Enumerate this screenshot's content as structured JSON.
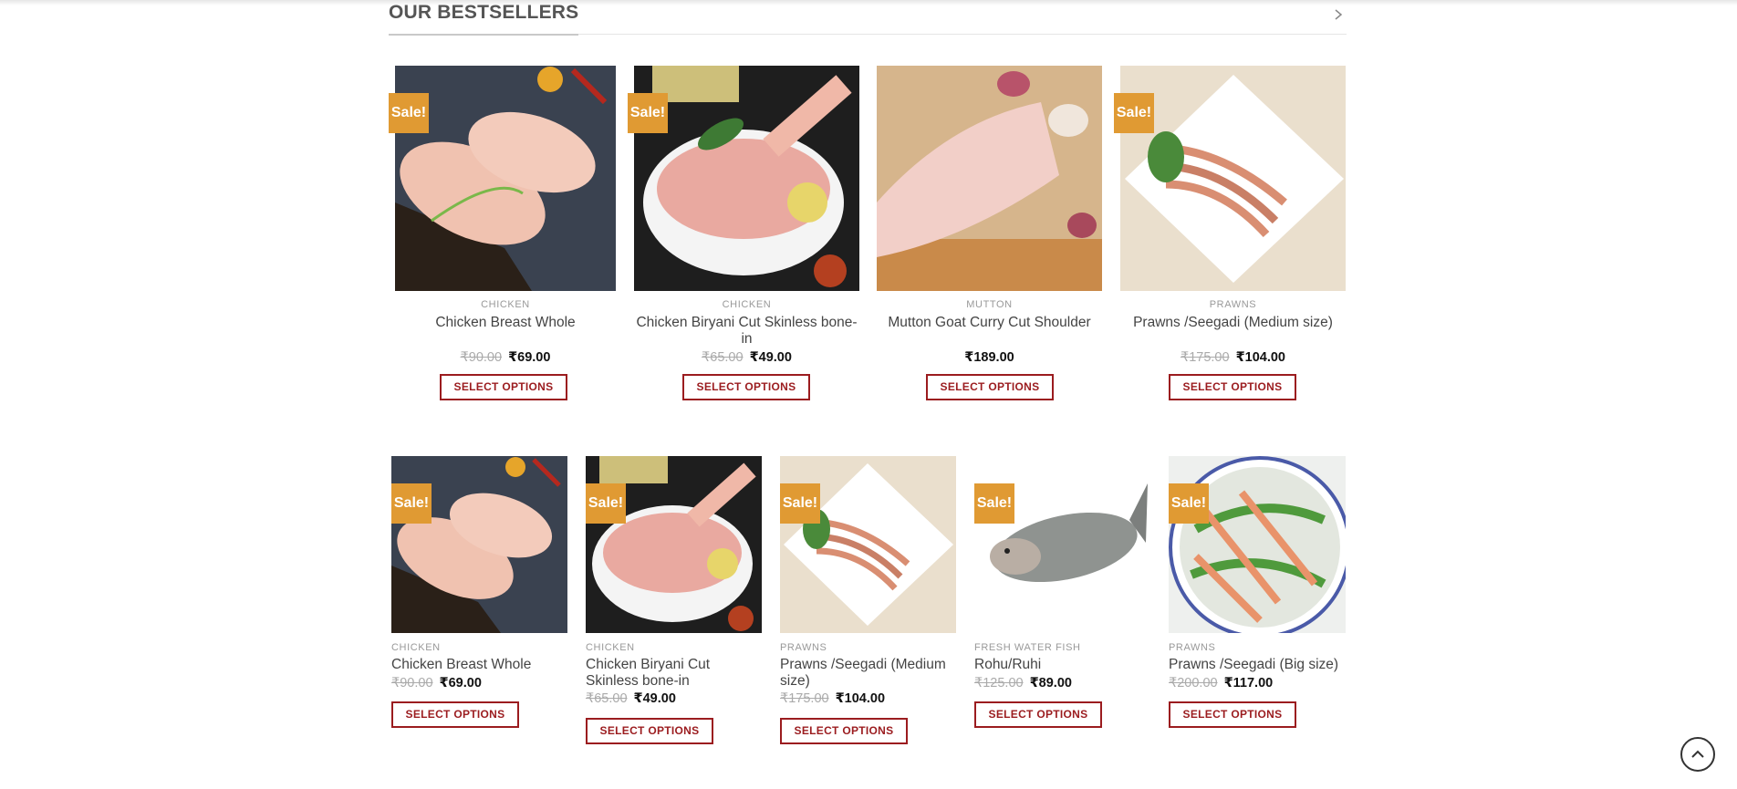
{
  "section": {
    "title": "OUR BESTSELLERS",
    "arrow_icon": "chevron-right-icon"
  },
  "badge": "Sale!",
  "button_label": "SELECT OPTIONS",
  "row1": [
    {
      "category": "CHICKEN",
      "title": "Chicken Breast Whole",
      "old_price": "₹90.00",
      "price": "₹69.00",
      "sale": true,
      "image": "chicken-breast"
    },
    {
      "category": "CHICKEN",
      "title": "Chicken Biryani Cut Skinless bone-in",
      "old_price": "₹65.00",
      "price": "₹49.00",
      "sale": true,
      "image": "chicken-bowl"
    },
    {
      "category": "MUTTON",
      "title": "Mutton Goat Curry Cut Shoulder",
      "old_price": "",
      "price": "₹189.00",
      "sale": false,
      "image": "mutton"
    },
    {
      "category": "PRAWNS",
      "title": "Prawns /Seegadi (Medium size)",
      "old_price": "₹175.00",
      "price": "₹104.00",
      "sale": true,
      "image": "prawns-plate"
    }
  ],
  "row2": [
    {
      "category": "CHICKEN",
      "title": "Chicken Breast Whole",
      "old_price": "₹90.00",
      "price": "₹69.00",
      "sale": true,
      "image": "chicken-breast"
    },
    {
      "category": "CHICKEN",
      "title": "Chicken Biryani Cut Skinless bone-in",
      "old_price": "₹65.00",
      "price": "₹49.00",
      "sale": true,
      "image": "chicken-bowl"
    },
    {
      "category": "PRAWNS",
      "title": "Prawns /Seegadi (Medium size)",
      "old_price": "₹175.00",
      "price": "₹104.00",
      "sale": true,
      "image": "prawns-plate"
    },
    {
      "category": "FRESH WATER FISH",
      "title": "Rohu/Ruhi",
      "old_price": "₹125.00",
      "price": "₹89.00",
      "sale": true,
      "image": "fish"
    },
    {
      "category": "PRAWNS",
      "title": "Prawns /Seegadi (Big size)",
      "old_price": "₹200.00",
      "price": "₹117.00",
      "sale": true,
      "image": "prawns-round"
    }
  ],
  "colors": {
    "sale_badge": "#e09a33",
    "button": "#9b1c1f"
  },
  "scroll_top_icon": "chevron-up-icon"
}
